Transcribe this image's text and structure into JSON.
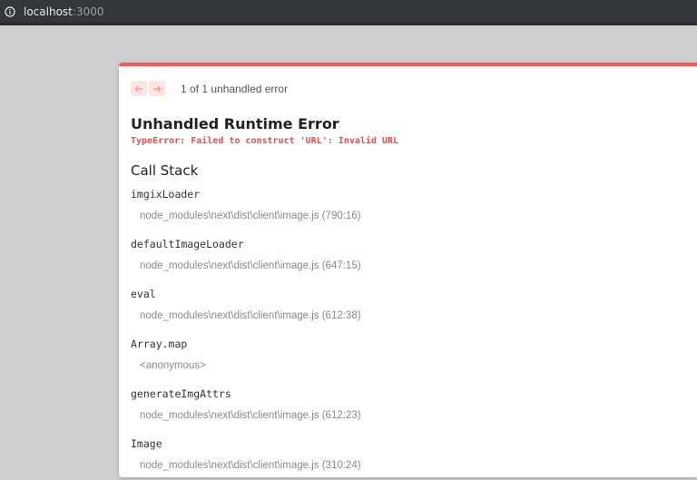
{
  "browser": {
    "url_host": "localhost",
    "url_port": ":3000",
    "info_icon": "info-circle-icon"
  },
  "error_overlay": {
    "accent_color": "#ff5555",
    "nav": {
      "prev_icon": "arrow-left-icon",
      "next_icon": "arrow-right-icon",
      "count_text": "1 of 1 unhandled error"
    },
    "title": "Unhandled Runtime Error",
    "message": "TypeError: Failed to construct 'URL': Invalid URL",
    "call_stack_heading": "Call Stack",
    "frames": [
      {
        "fn": "imgixLoader",
        "loc": "node_modules\\next\\dist\\client\\image.js (790:16)"
      },
      {
        "fn": "defaultImageLoader",
        "loc": "node_modules\\next\\dist\\client\\image.js (647:15)"
      },
      {
        "fn": "eval",
        "loc": "node_modules\\next\\dist\\client\\image.js (612:38)"
      },
      {
        "fn": "Array.map",
        "loc": "<anonymous>"
      },
      {
        "fn": "generateImgAttrs",
        "loc": "node_modules\\next\\dist\\client\\image.js (612:23)"
      },
      {
        "fn": "Image",
        "loc": "node_modules\\next\\dist\\client\\image.js (310:24)"
      }
    ]
  }
}
